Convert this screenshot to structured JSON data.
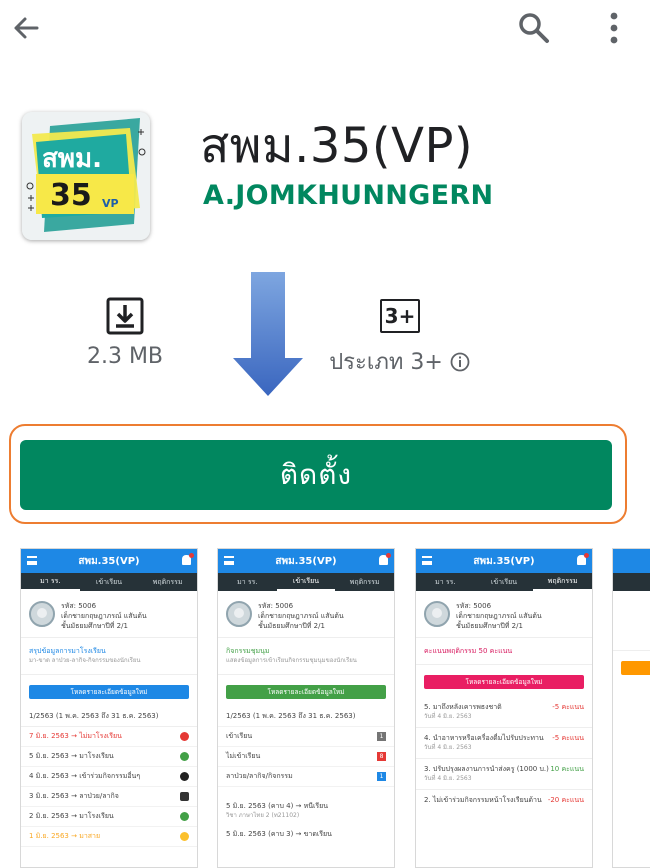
{
  "toolbar": {
    "back_icon": "arrow-left-icon",
    "search_icon": "search-icon",
    "more_icon": "more-vert-icon"
  },
  "app": {
    "title": "สพม.35(VP)",
    "developer": "A.JOMKHUNNGERN",
    "icon_text_top": "สพม.",
    "icon_text_bottom": "35",
    "icon_text_sub": "VP"
  },
  "stats": {
    "size_label": "2.3 MB",
    "rating_badge": "3+",
    "rating_label": "ประเภท 3+"
  },
  "install": {
    "label": "ติดตั้ง"
  },
  "colors": {
    "accent_green": "#01875f",
    "highlight_orange": "#ed7d31",
    "arrow_blue": "#4472c4",
    "screenshot_header": "#1e88e5"
  },
  "screenshots": [
    {
      "header": "สพม.35(VP)",
      "tabs": [
        "มา รร.",
        "เข้าเรียน",
        "พฤติกรรม"
      ],
      "profile_id": "รหัส: 5006",
      "profile_name": "เด็กชายกฤษฎาภรณ์ แสันต้น",
      "profile_class": "ชั้นมัธยมศึกษาปีที่ 2/1",
      "section": "สรุปข้อมูลการมาโรงเรียน",
      "section_sub": "มา-ขาด ลาป่วย-ลากิจ-กิจกรรมของนักเรียน",
      "bar": "โหลดรายละเอียดข้อมูลใหม่",
      "term": "1/2563 (1 พ.ค. 2563 ถึง 31 ธ.ค. 2563)",
      "rows": [
        {
          "text": "7 มิ.ย. 2563 → ไม่มาโรงเรียน"
        },
        {
          "text": "5 มิ.ย. 2563 → มาโรงเรียน"
        },
        {
          "text": "4 มิ.ย. 2563 → เข้าร่วมกิจกรรมอื่นๆ"
        },
        {
          "text": "3 มิ.ย. 2563 → ลาป่วย/ลากิจ"
        },
        {
          "text": "2 มิ.ย. 2563 → มาโรงเรียน"
        },
        {
          "text": "1 มิ.ย. 2563 → มาสาย"
        }
      ]
    },
    {
      "header": "สพม.35(VP)",
      "tabs": [
        "มา รร.",
        "เข้าเรียน",
        "พฤติกรรม"
      ],
      "profile_id": "รหัส: 5006",
      "profile_name": "เด็กชายกฤษฎาภรณ์ แสันต้น",
      "profile_class": "ชั้นมัธยมศึกษาปีที่ 2/1",
      "section": "กิจกรรมชุมนุม",
      "section_sub": "แสดงข้อมูลการเข้าเรียนกิจกรรมชุมนุมของนักเรียน",
      "bar": "โหลดรายละเอียดข้อมูลใหม่",
      "term": "1/2563 (1 พ.ค. 2563 ถึง 31 ธ.ค. 2563)",
      "rows": [
        {
          "text": "เข้าเรียน",
          "count": "1"
        },
        {
          "text": "ไม่เข้าเรียน",
          "count": "8"
        },
        {
          "text": "ลาป่วย/ลากิจ/กิจกรรม",
          "count": "1"
        }
      ],
      "extra1": "5 มิ.ย. 2563 (คาบ 4) → หนีเรียน",
      "extra1_sub": "วิชา ภาษาไทย 2 (ท21102)",
      "extra2": "5 มิ.ย. 2563 (คาบ 3) → ขาดเรียน"
    },
    {
      "header": "สพม.35(VP)",
      "tabs": [
        "มา รร.",
        "เข้าเรียน",
        "พฤติกรรม"
      ],
      "profile_id": "รหัส: 5006",
      "profile_name": "เด็กชายกฤษฎาภรณ์ แสันต้น",
      "profile_class": "ชั้นมัธยมศึกษาปีที่ 2/1",
      "section": "คะแนนพฤติกรรม 50 คะแนน",
      "bar": "โหลดรายละเอียดข้อมูลใหม่",
      "rows": [
        {
          "text": "5. มาถึงหลังเคารพธงชาติ",
          "score": "-5 คะแนน",
          "sub": "วันที่ 4 มิ.ย. 2563"
        },
        {
          "text": "4. นำอาหารหรือเครื่องดื่มไปรับประทาน",
          "score": "-5 คะแนน",
          "sub": "วันที่ 4 มิ.ย. 2563"
        },
        {
          "text": "3. ปรับปรุงผลงานการนำส่งครู (1000 บ.)",
          "score": "10 คะแนน",
          "sub": "วันที่ 4 มิ.ย. 2563"
        },
        {
          "text": "2. ไม่เข้าร่วมกิจกรรมหน้าโรงเรียนด้าน",
          "score": "-20 คะแนน",
          "sub": ""
        }
      ]
    }
  ]
}
